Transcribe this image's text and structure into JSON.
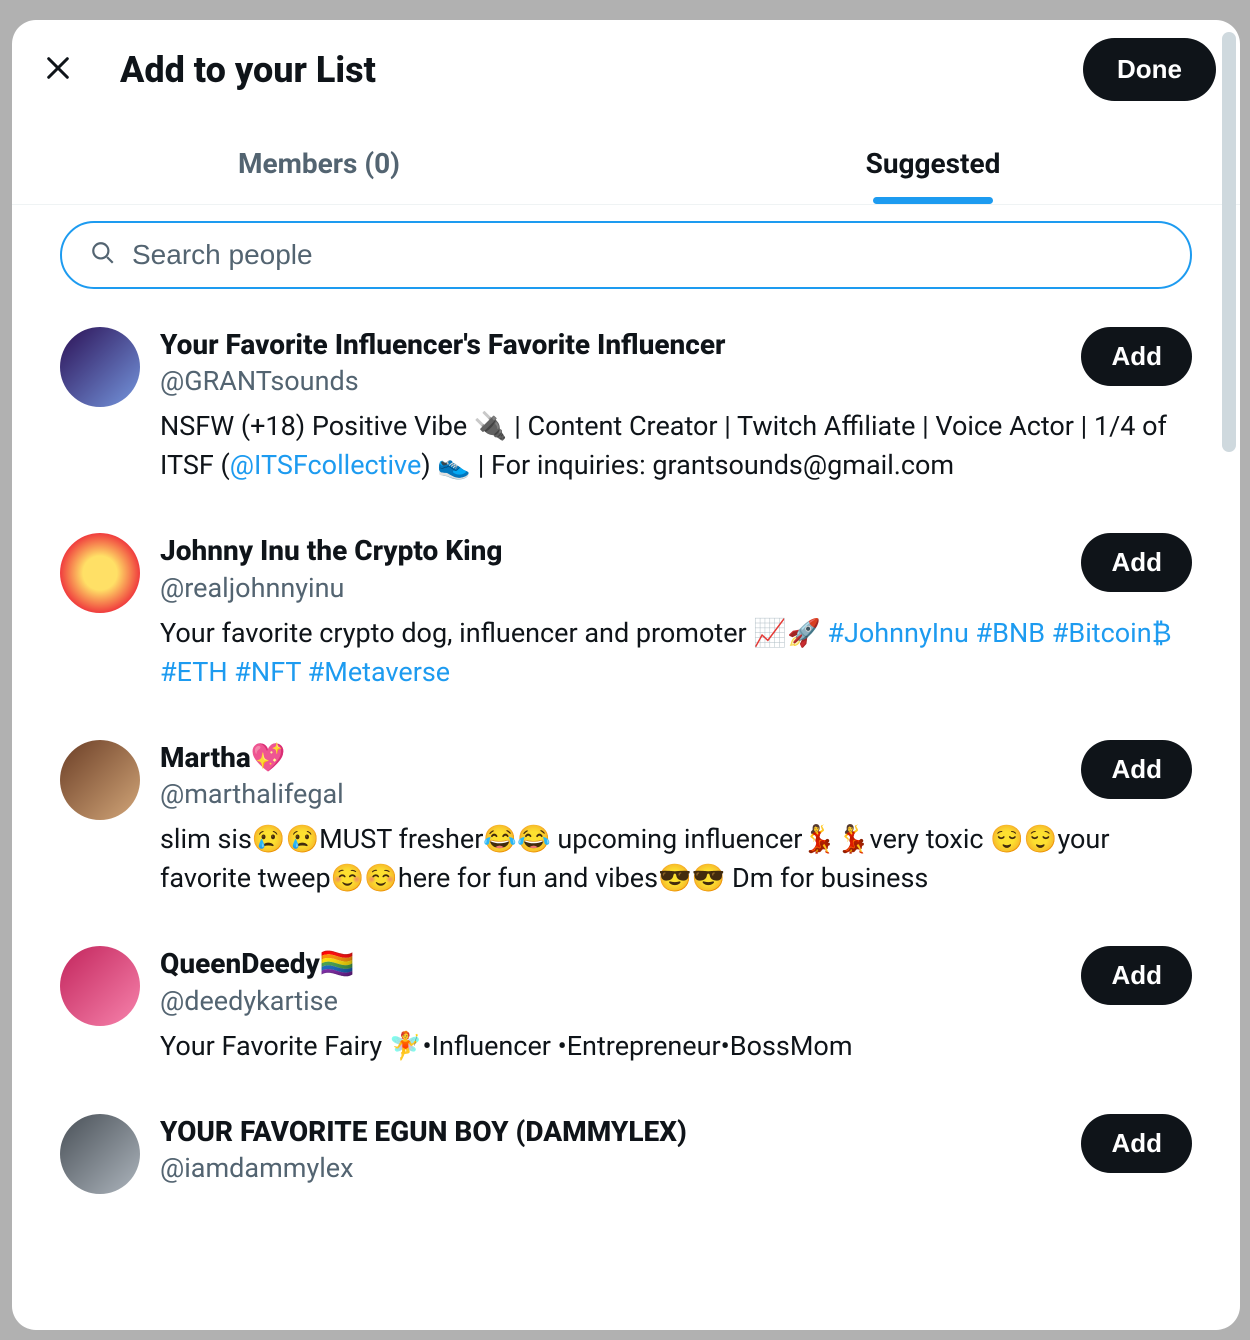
{
  "header": {
    "title": "Add to your List",
    "done_label": "Done"
  },
  "tabs": {
    "members_label": "Members (0)",
    "suggested_label": "Suggested"
  },
  "search": {
    "placeholder": "Search people"
  },
  "buttons": {
    "add_label": "Add"
  },
  "people": [
    {
      "display_name": "Your Favorite Influencer's Favorite Influencer",
      "handle": "@GRANTsounds",
      "bio_plain_before": "NSFW (+18) Positive Vibe 🔌 | Content Creator | Twitch Affiliate | Voice Actor | 1/4 of ITSF (",
      "bio_link": "@ITSFcollective",
      "bio_plain_after": ") 👟 | For inquiries: grantsounds@gmail.com"
    },
    {
      "display_name": "Johnny Inu the Crypto King",
      "handle": "@realjohnnyinu",
      "bio_plain_before": "Your favorite crypto dog, influencer and promoter 📈🚀 ",
      "bio_hashtags": "#JohnnyInu #BNB #Bitcoin₿  #ETH #NFT #Metaverse"
    },
    {
      "display_name": "Martha💖",
      "handle": "@marthalifegal",
      "bio_plain_before": "slim sis😢😢MUST fresher😂😂 upcoming influencer💃💃very toxic 😌😌your favorite tweep☺️☺️here for fun and vibes😎😎 Dm for business"
    },
    {
      "display_name": "QueenDeedy🏳️‍🌈",
      "handle": "@deedykartise",
      "bio_plain_before": "Your Favorite Fairy 🧚•Influencer •Entrepreneur•BossMom"
    },
    {
      "display_name": "YOUR FAVORITE EGUN BOY (DAMMYLEX)",
      "handle": "@iamdammylex",
      "bio_plain_before": ""
    }
  ]
}
